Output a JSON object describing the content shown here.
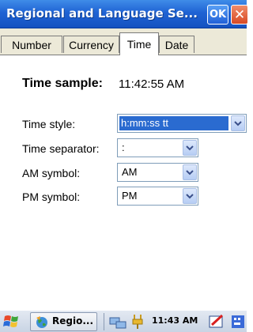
{
  "window": {
    "title": "Regional and Language Se...",
    "ok_label": "OK",
    "close_label": "✕"
  },
  "tabs": [
    {
      "label": "Number",
      "active": false
    },
    {
      "label": "Currency",
      "active": false
    },
    {
      "label": "Time",
      "active": true
    },
    {
      "label": "Date",
      "active": false
    }
  ],
  "time_sample": {
    "label": "Time sample:",
    "value": "11:42:55 AM"
  },
  "fields": {
    "time_style": {
      "label": "Time style:",
      "value": "h:mm:ss tt"
    },
    "time_separator": {
      "label": "Time separator:",
      "value": ":"
    },
    "am_symbol": {
      "label": "AM symbol:",
      "value": "AM"
    },
    "pm_symbol": {
      "label": "PM symbol:",
      "value": "PM"
    }
  },
  "taskbar": {
    "task_label": "Regio...",
    "clock": "11:43 AM"
  },
  "colors": {
    "titlebar": "#1f63d4",
    "selection": "#2a6bd0",
    "tab_bg": "#ece9d8"
  }
}
